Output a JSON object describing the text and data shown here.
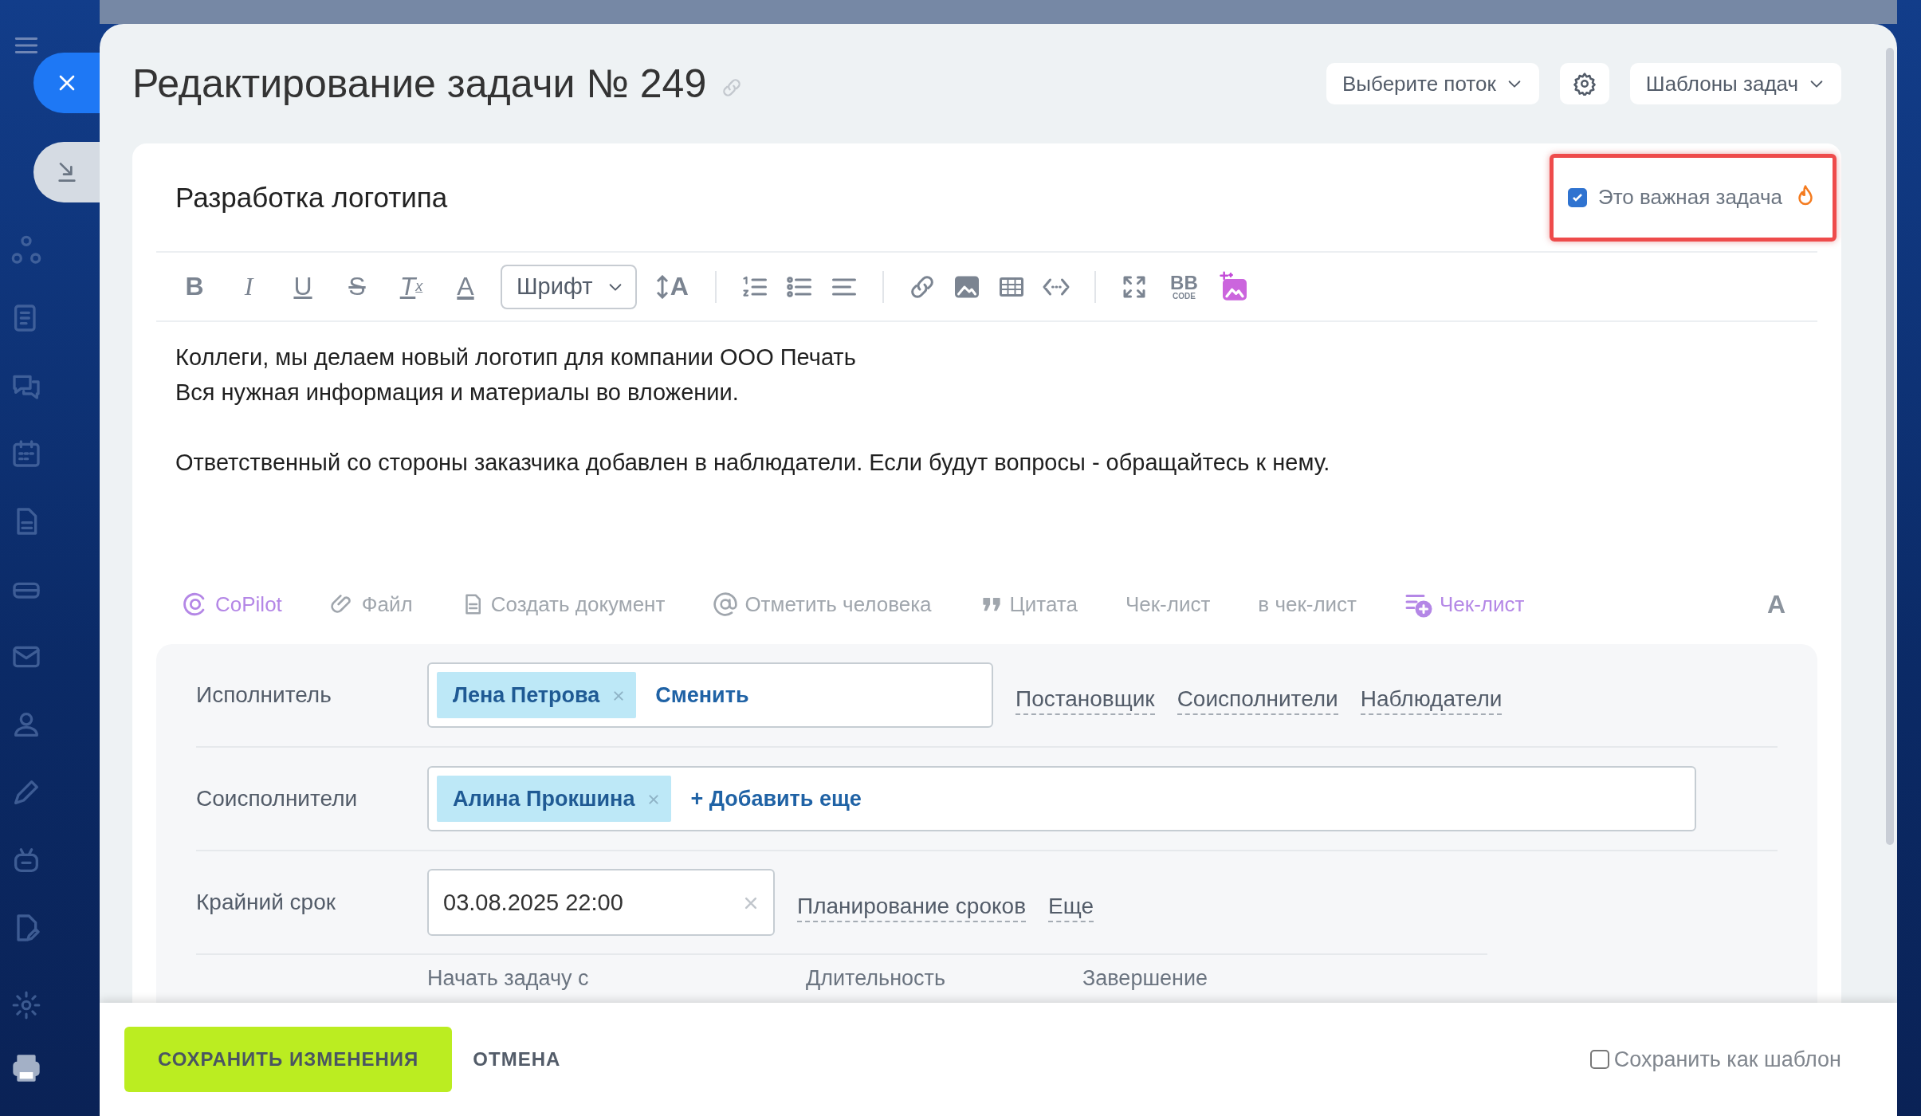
{
  "header": {
    "title": "Редактирование задачи № 249",
    "flow_button": "Выберите поток",
    "templates_button": "Шаблоны задач"
  },
  "task": {
    "title": "Разработка логотипа",
    "important": {
      "label": "Это важная задача",
      "checked": true
    }
  },
  "toolbar": [
    {
      "kind": "bold",
      "text": "B"
    },
    {
      "kind": "italic",
      "text": "I"
    },
    {
      "kind": "underline",
      "text": "U"
    },
    {
      "kind": "strike",
      "text": "S"
    },
    {
      "kind": "clear",
      "text": "T",
      "sub": "x"
    },
    {
      "kind": "color",
      "text": "A"
    },
    {
      "kind": "select",
      "text": "Шрифт"
    },
    {
      "kind": "size",
      "text": "A"
    },
    {
      "kind": "separator"
    },
    {
      "kind": "ordered-list"
    },
    {
      "kind": "bullet-list"
    },
    {
      "kind": "align"
    },
    {
      "kind": "separator"
    },
    {
      "kind": "link"
    },
    {
      "kind": "image"
    },
    {
      "kind": "table"
    },
    {
      "kind": "code"
    },
    {
      "kind": "separator"
    },
    {
      "kind": "fullscreen"
    },
    {
      "kind": "bbcode",
      "text": "BB",
      "sub": "CODE"
    },
    {
      "kind": "ai-image"
    }
  ],
  "body": [
    [
      "Коллеги, мы делаем новый логотип для компании ООО Печать",
      "Вся нужная информация и материалы во вложении."
    ],
    [
      "Ответственный со стороны заказчика добавлен в наблюдатели. Если будут вопросы - обращайтесь к нему."
    ]
  ],
  "attach_bar": [
    {
      "kind": "copilot",
      "label": "CoPilot"
    },
    {
      "kind": "file",
      "label": "Файл"
    },
    {
      "kind": "document",
      "label": "Создать документ"
    },
    {
      "kind": "mention",
      "label": "Отметить человека"
    },
    {
      "kind": "quote",
      "label": "Цитата"
    },
    {
      "kind": "plain",
      "label": "Чек-лист"
    },
    {
      "kind": "plain",
      "label": "в чек-лист"
    },
    {
      "kind": "checklist-ai",
      "label": "Чек-лист"
    },
    {
      "kind": "format",
      "label": "A"
    }
  ],
  "form": {
    "rows": [
      {
        "label": "Исполнитель",
        "tags": [
          "Лена Петрова"
        ],
        "action": "Сменить",
        "links": [
          "Постановщик",
          "Соисполнители",
          "Наблюдатели"
        ]
      },
      {
        "label": "Соисполнители",
        "tags": [
          "Алина Прокшина"
        ],
        "action": "+ Добавить еще",
        "links": []
      }
    ],
    "deadline": {
      "label": "Крайний срок",
      "value": "03.08.2025 22:00",
      "links": [
        "Планирование сроков",
        "Еще"
      ]
    },
    "schedule": [
      "Начать задачу с",
      "Длительность",
      "Завершение"
    ]
  },
  "footer": {
    "save": "СОХРАНИТЬ ИЗМЕНЕНИЯ",
    "cancel": "ОТМЕНА",
    "template": {
      "label": "Сохранить как шаблон",
      "checked": false
    }
  }
}
